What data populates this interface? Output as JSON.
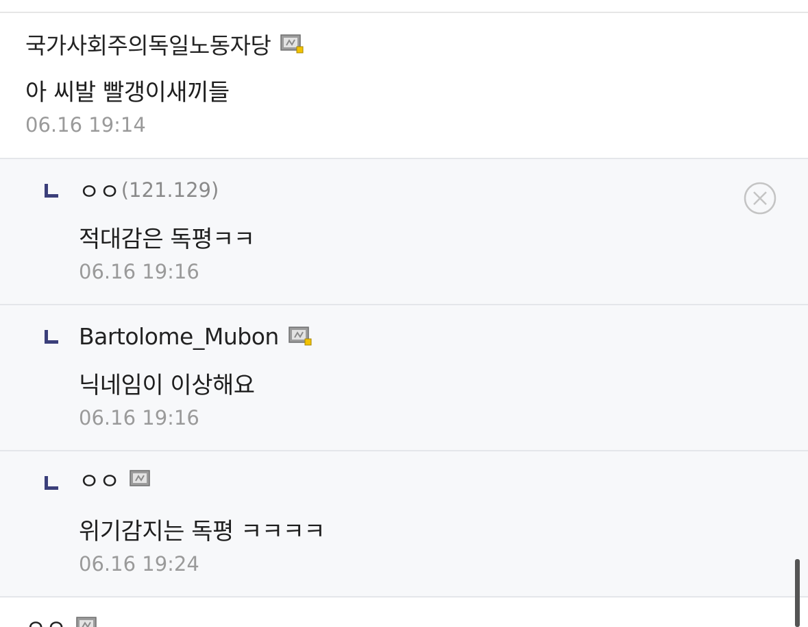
{
  "comments": [
    {
      "nickname": "국가사회주의독일노동자당",
      "ip": "",
      "has_gall_icon": true,
      "text": "아 씨발 빨갱이새끼들",
      "date": "06.16 19:14",
      "is_reply": false
    },
    {
      "nickname": "ㅇㅇ",
      "ip": "(121.129)",
      "has_gall_icon": false,
      "text": "적대감은 독평ㅋㅋ",
      "date": "06.16 19:16",
      "is_reply": true
    },
    {
      "nickname": "Bartolome_Mubon",
      "ip": "",
      "has_gall_icon": true,
      "text": "닉네임이 이상해요",
      "date": "06.16 19:16",
      "is_reply": true
    },
    {
      "nickname": "ㅇㅇ",
      "ip": "",
      "has_gall_icon": true,
      "text": "위기감지는 독평 ㅋㅋㅋㅋ",
      "date": "06.16 19:24",
      "is_reply": true
    },
    {
      "nickname": "ㅇㅇ",
      "ip": "",
      "has_gall_icon": true,
      "text": "",
      "date": "",
      "is_reply": false
    }
  ],
  "icons": {
    "reply": "reply-arrow-icon",
    "gallery_member": "gallery-member-icon",
    "delete": "close-circle-icon"
  },
  "colors": {
    "reply_marker": "#3b3f7a",
    "reply_background": "#f7f8fa",
    "date_text": "#9a9a9a",
    "fixed_member_badge": "#f2c200"
  }
}
